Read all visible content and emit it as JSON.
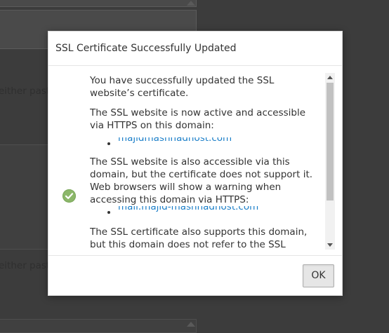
{
  "background": {
    "partial_text_1": "either paste",
    "partial_text_2": "either paste"
  },
  "modal": {
    "title": "SSL Certificate Successfully Updated",
    "status_icon": "check-circle-icon",
    "paragraphs": {
      "p1": "You have successfully updated the SSL website’s certificate.",
      "p2": "The SSL website is now active and accessible via HTTPS on this domain:",
      "p3": "The SSL website is also accessible via this domain, but the certificate does not support it. Web browsers will show a warning when accessing this domain via HTTPS:",
      "p4": "The SSL certificate also supports this domain, but this domain does not refer to the SSL website"
    },
    "domains": {
      "primary": "majidmashhadhost.com",
      "mail": "mail.majid-mashhadhost.com"
    },
    "ok_label": "OK"
  },
  "colors": {
    "link": "#1a7ec8",
    "check_icon": "#8cb76a",
    "backdrop": "#3c3c3c"
  }
}
